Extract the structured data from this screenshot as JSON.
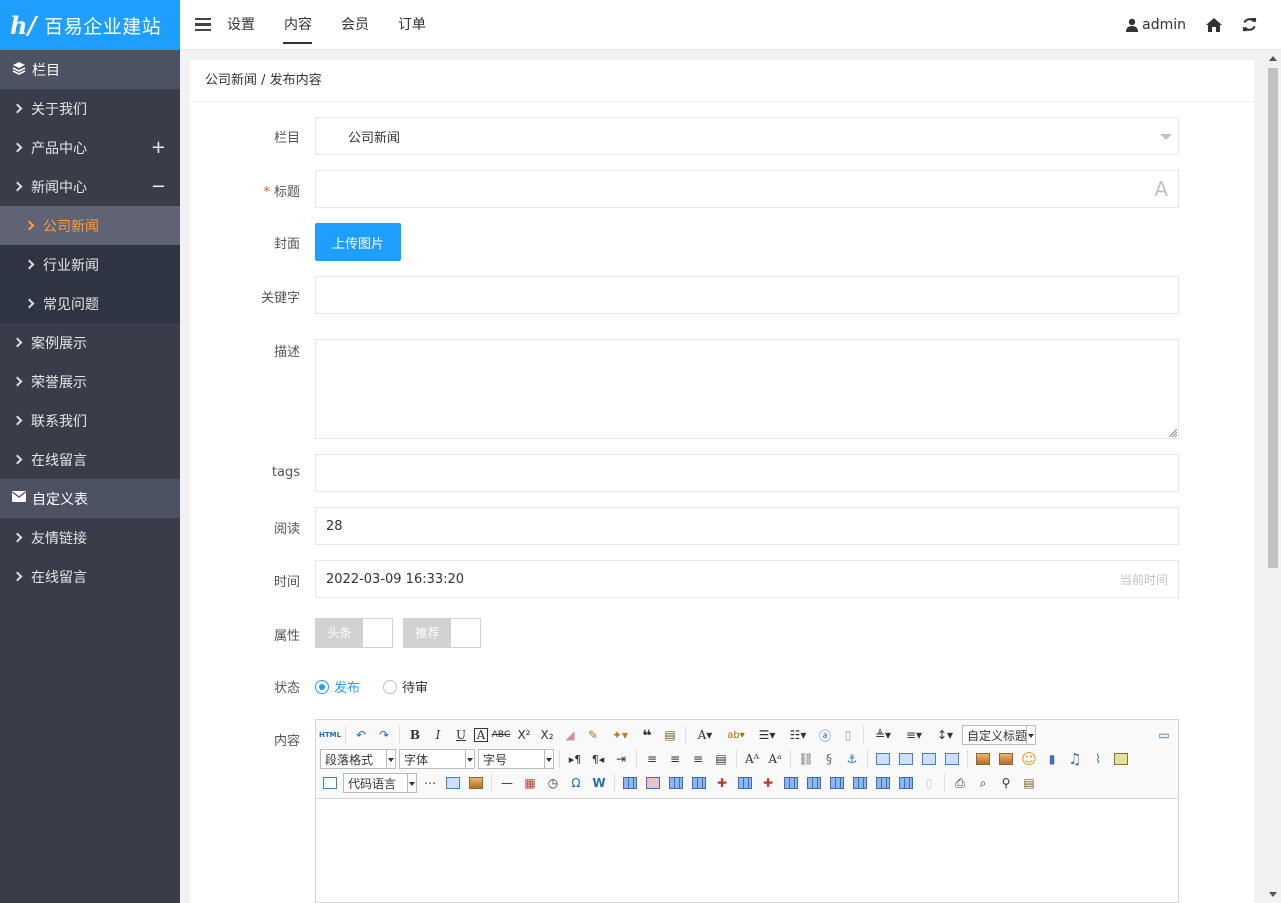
{
  "app": {
    "logo_mark": "h/",
    "title": "百易企业建站"
  },
  "header": {
    "nav": [
      "设置",
      "内容",
      "会员",
      "订单"
    ],
    "active_nav": "内容",
    "user": "admin"
  },
  "sidebar": {
    "section1": "栏目",
    "items": [
      {
        "label": "关于我们"
      },
      {
        "label": "产品中心",
        "toggle": "+"
      },
      {
        "label": "新闻中心",
        "toggle": "−"
      }
    ],
    "subitems": [
      {
        "label": "公司新闻",
        "active": true
      },
      {
        "label": "行业新闻"
      },
      {
        "label": "常见问题"
      }
    ],
    "items2": [
      {
        "label": "案例展示"
      },
      {
        "label": "荣誉展示"
      },
      {
        "label": "联系我们"
      },
      {
        "label": "在线留言"
      }
    ],
    "section2": "自定义表",
    "items3": [
      {
        "label": "友情链接"
      },
      {
        "label": "在线留言"
      }
    ]
  },
  "breadcrumb": "公司新闻 / 发布内容",
  "form": {
    "column_label": "栏目",
    "column_value": "公司新闻",
    "title_label": "标题",
    "title_required": "*",
    "title_glyph": "A",
    "cover_label": "封面",
    "upload_button": "上传图片",
    "keywords_label": "关键字",
    "description_label": "描述",
    "tags_label": "tags",
    "views_label": "阅读",
    "views_value": "28",
    "time_label": "时间",
    "time_value": "2022-03-09 16:33:20",
    "time_hint": "当前时间",
    "attr_label": "属性",
    "attr_headline": "头条",
    "attr_recommend": "推荐",
    "status_label": "状态",
    "status_publish": "发布",
    "status_pending": "待审",
    "content_label": "内容"
  },
  "editor": {
    "custom_title": "自定义标题",
    "paragraph": "段落格式",
    "font": "字体",
    "size": "字号",
    "code_lang": "代码语言"
  },
  "colors": {
    "accent": "#1e9fff",
    "sidebar": "#393d49",
    "active": "#ff9d3b"
  }
}
